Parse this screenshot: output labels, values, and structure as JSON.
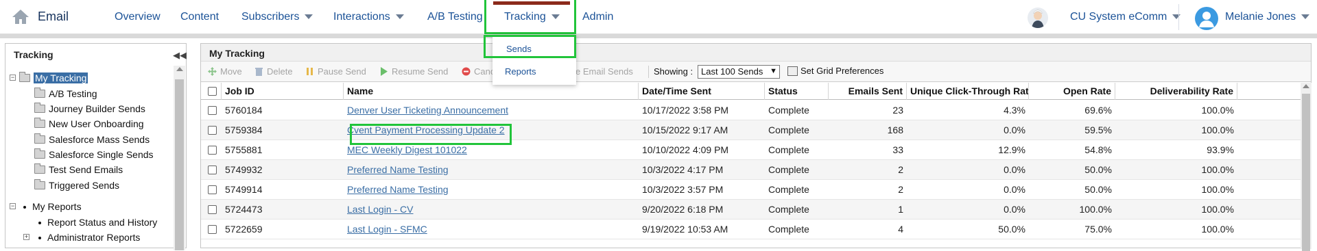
{
  "topnav": {
    "app_name": "Email",
    "items": [
      {
        "label": "Overview"
      },
      {
        "label": "Content"
      },
      {
        "label": "Subscribers"
      },
      {
        "label": "Interactions"
      },
      {
        "label": "A/B Testing"
      },
      {
        "label": "Tracking"
      },
      {
        "label": "Admin"
      }
    ],
    "org_name": "CU System eComm",
    "user_name": "Melanie Jones"
  },
  "dropdown": {
    "items": [
      {
        "label": "Sends"
      },
      {
        "label": "Reports"
      }
    ]
  },
  "left_panel": {
    "title": "Tracking",
    "tree": {
      "my_tracking": "My Tracking",
      "children": [
        "A/B Testing",
        "Journey Builder Sends",
        "New User Onboarding",
        "Salesforce Mass Sends",
        "Salesforce Single Sends",
        "Test Send Emails",
        "Triggered Sends"
      ],
      "my_reports": "My Reports",
      "report_children": [
        "Report Status and History",
        "Administrator Reports"
      ]
    }
  },
  "main": {
    "title": "My Tracking",
    "toolbar": {
      "move": "Move",
      "delete": "Delete",
      "pause_send": "Pause Send",
      "resume_send": "Resume Send",
      "cancel_partial": "Canc",
      "compare_partial": "npare Email Sends",
      "showing_label": "Showing :",
      "showing_value": "Last 100 Sends",
      "grid_pref": "Set Grid Preferences"
    },
    "columns": [
      "Job ID",
      "Name",
      "Date/Time Sent",
      "Status",
      "Emails Sent",
      "Unique Click-Through Rate",
      "Open Rate",
      "Deliverability Rate"
    ],
    "rows": [
      {
        "job_id": "5760184",
        "name": "Denver User Ticketing Announcement",
        "date": "10/17/2022 3:58 PM",
        "status": "Complete",
        "emails_sent": "23",
        "ctr": "4.3%",
        "open_rate": "69.6%",
        "deliverability": "100.0%"
      },
      {
        "job_id": "5759384",
        "name": "Cvent Payment Processing Update 2",
        "date": "10/15/2022 9:17 AM",
        "status": "Complete",
        "emails_sent": "168",
        "ctr": "0.0%",
        "open_rate": "59.5%",
        "deliverability": "100.0%"
      },
      {
        "job_id": "5755881",
        "name": "MEC Weekly Digest 101022",
        "date": "10/10/2022 4:09 PM",
        "status": "Complete",
        "emails_sent": "33",
        "ctr": "12.9%",
        "open_rate": "54.8%",
        "deliverability": "93.9%"
      },
      {
        "job_id": "5749932",
        "name": "Preferred Name Testing",
        "date": "10/3/2022 4:17 PM",
        "status": "Complete",
        "emails_sent": "2",
        "ctr": "0.0%",
        "open_rate": "50.0%",
        "deliverability": "100.0%"
      },
      {
        "job_id": "5749914",
        "name": "Preferred Name Testing",
        "date": "10/3/2022 3:57 PM",
        "status": "Complete",
        "emails_sent": "2",
        "ctr": "0.0%",
        "open_rate": "50.0%",
        "deliverability": "100.0%"
      },
      {
        "job_id": "5724473",
        "name": "Last Login - CV",
        "date": "9/20/2022 6:18 PM",
        "status": "Complete",
        "emails_sent": "1",
        "ctr": "0.0%",
        "open_rate": "100.0%",
        "deliverability": "100.0%"
      },
      {
        "job_id": "5722659",
        "name": "Last Login - SFMC",
        "date": "9/19/2022 10:53 AM",
        "status": "Complete",
        "emails_sent": "4",
        "ctr": "50.0%",
        "open_rate": "75.0%",
        "deliverability": "100.0%"
      }
    ]
  },
  "colors": {
    "highlight": "#21c43a",
    "link": "#3a6ea5",
    "nav_text": "#1b5297",
    "tracking_bar": "#8b2a1b"
  }
}
